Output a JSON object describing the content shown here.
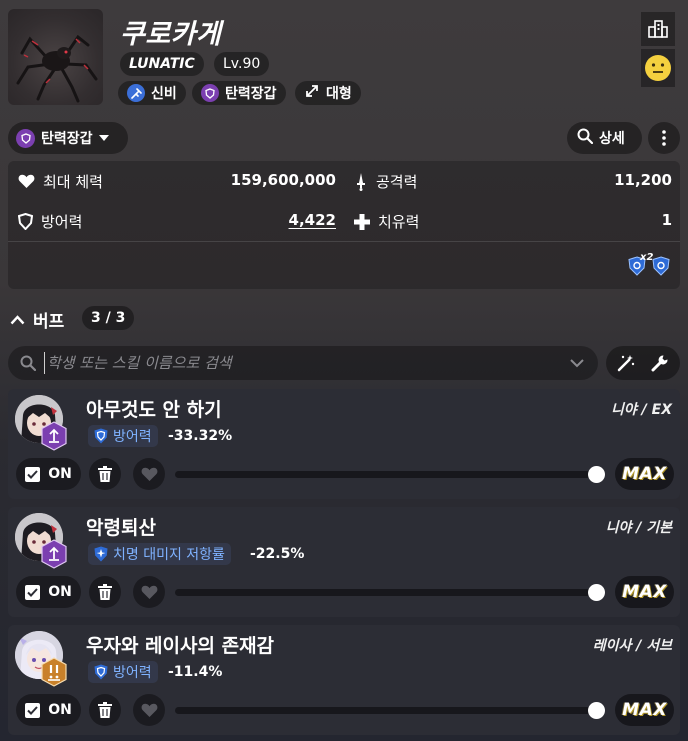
{
  "boss": {
    "name": "쿠로카게",
    "difficulty": "LUNATIC",
    "level": "Lv.90",
    "attack_type": "신비",
    "armor_type": "탄력장갑",
    "size": "대형"
  },
  "armor_dropdown": {
    "label": "탄력장갑"
  },
  "detail_button": {
    "label": "상세"
  },
  "stats": {
    "max_hp_label": "최대 체력",
    "max_hp": "159,600,000",
    "attack_label": "공격력",
    "attack": "11,200",
    "defense_label": "방어력",
    "defense": "4,422",
    "healing_label": "치유력",
    "healing": "1",
    "shield_multiplier": "x2"
  },
  "buffs": {
    "title": "버프",
    "count": "3 / 3",
    "search_placeholder": "학생 또는 스킬 이름으로 검색",
    "items": [
      {
        "name": "아무것도 안 하기",
        "source": "니야 / EX",
        "effect_label": "방어력",
        "effect_value": "-33.32%",
        "toggle_label": "ON",
        "max_label": "MAX",
        "level": 1.0
      },
      {
        "name": "악령퇴산",
        "source": "니야 / 기본",
        "effect_label": "치명 대미지 저항률",
        "effect_value": "-22.5%",
        "toggle_label": "ON",
        "max_label": "MAX",
        "level": 1.0
      },
      {
        "name": "우자와 레이사의 존재감",
        "source": "레이사 / 서브",
        "effect_label": "방어력",
        "effect_value": "-11.4%",
        "toggle_label": "ON",
        "max_label": "MAX",
        "level": 1.0
      }
    ]
  },
  "colors": {
    "mystic_blue": "#3b6fd8",
    "elastic_purple": "#7b3fb0",
    "effect_text": "#7fb2ff",
    "support_orange": "#c9812a"
  }
}
